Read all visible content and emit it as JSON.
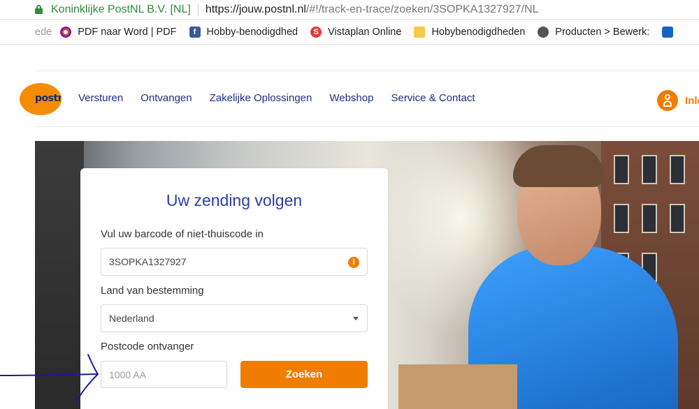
{
  "browser": {
    "site_owner": "Koninklijke PostNL B.V. [NL]",
    "url_domain": "https://jouw.postnl.nl",
    "url_path": "/#!/track-en-trace/zoeken/3SOPKA1327927/NL"
  },
  "bookmarks": [
    {
      "label": "ede",
      "icon": "truncated-bookmark"
    },
    {
      "label": "PDF naar Word | PDF",
      "icon": "pdf-converter-icon"
    },
    {
      "label": "Hobby-benodigdhed",
      "icon": "facebook-icon"
    },
    {
      "label": "Vistaplan Online",
      "icon": "vistaplan-icon"
    },
    {
      "label": "Hobybenodigdheden",
      "icon": "folder-icon"
    },
    {
      "label": "Producten > Bewerk:",
      "icon": "gear-icon"
    }
  ],
  "nav": {
    "logo_text": "postnl",
    "links": [
      "Versturen",
      "Ontvangen",
      "Zakelijke Oplossingen",
      "Webshop",
      "Service & Contact"
    ],
    "login_label": "Inlo"
  },
  "tracking": {
    "title": "Uw zending volgen",
    "barcode_label": "Vul uw barcode of niet-thuiscode in",
    "barcode_value": "3SOPKA1327927",
    "destination_label": "Land van bestemming",
    "destination_value": "Nederland",
    "postcode_label": "Postcode ontvanger",
    "postcode_placeholder": "1000 AA",
    "search_label": "Zoeken"
  },
  "colors": {
    "brand_orange": "#f07d00",
    "brand_blue": "#1d2e8a",
    "secure_green": "#2e8b3d",
    "annotation_blue": "#1a1aa0"
  }
}
